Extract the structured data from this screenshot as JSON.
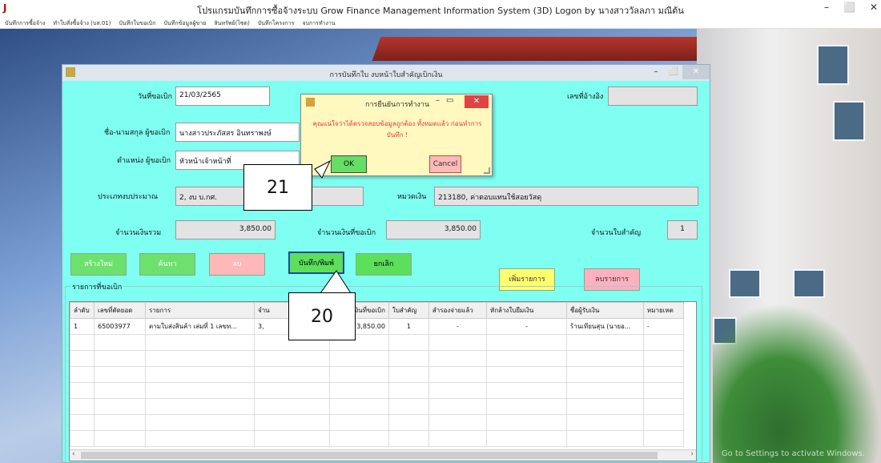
{
  "main_window": {
    "logo": "J",
    "title": "โปรแกรมบันทึกการซื้อจ้างระบบ  Grow Finance Management Information System (3D) Logon by นางสาววัลลภา  มณีต้น",
    "controls": [
      "–",
      "⬜",
      "✕"
    ]
  },
  "menubar": {
    "items": [
      "บันทึกการซื้อจ้าง",
      "ทำใบสั่งซื้อจ้าง (บส.01)",
      "บันทึกใบขอเบิก",
      "บันทึกข้อมูลผู้ขาย",
      "สินทรัพย์(ไซด)",
      "บันทึกโครงการ",
      "จบการทำงาน"
    ]
  },
  "form": {
    "title": "การบันทึกใบ งบหน้าใบสำคัญเบิกเงิน",
    "fields": {
      "request_date_label": "วันที่ขอเบิก",
      "request_date": "21/03/2565",
      "ref_no_label": "เลขที่อ้างอิง",
      "ref_no": "",
      "requester_label": "ชื่อ-นามสกุล ผู้ขอเบิก",
      "requester": "นางสาวประภัสสร  อินทราพงษ์",
      "position_label": "ตำแหน่ง ผู้ขอเบิก",
      "position": "หัวหน้าเจ้าหน้าที่",
      "budget_type_label": "ประเภทงบประมาณ",
      "budget_type": "2, งบ บ.กศ.",
      "category_label": "หมวดเงิน",
      "category": "213180, ค่าตอบแทนใช้สอยวัสดุ",
      "total_label": "จำนวนเงินรวม",
      "total": "3,850.00",
      "requested_amount_label": "จำนวนเงินที่ขอเบิก",
      "requested_amount": "3,850.00",
      "voucher_count_label": "จำนวนใบสำคัญ",
      "voucher_count": "1"
    },
    "buttons": {
      "new": "สร้างใหม่",
      "search": "ค้นหา",
      "delete": "ลบ",
      "save_print": "บันทึก/พิมพ์",
      "cancel": "ยกเลิก",
      "add_item": "เพิ่มรายการ",
      "delete_item": "ลบรายการ"
    },
    "group_title": "รายการที่ขอเบิก",
    "table": {
      "columns": [
        "ลำดับ",
        "เลขที่ตัดยอด",
        "รายการ",
        "จำน",
        "จำนวนเงินที่ขอเบิก",
        "ใบสำคัญ",
        "สำรองจ่ายแล้ว",
        "หักล้างใบยืมเงิน",
        "ชื่อผู้รับเงิน",
        "หมายเหต"
      ],
      "rows": [
        [
          "1",
          "65003977",
          "ตามใบส่งสินค้า เล่มที่ 1  เลขท...",
          "3,",
          "3,850.00",
          "1",
          "-",
          "-",
          "ร้านเทียนสุน (นายอ...",
          "-"
        ]
      ]
    }
  },
  "dialog": {
    "title": "การยืนยันการทำงาน",
    "message": "คุณแน่ใจว่าได้ตรวจสอบข้อมูลถูกต้อง ทั้งหมดแล้ว ก่อนทำการบันทึก !",
    "ok": "OK",
    "cancel": "Cancel"
  },
  "callouts": {
    "step_20": "20",
    "step_21": "21"
  },
  "watermark": "Go to Settings to activate Windows."
}
